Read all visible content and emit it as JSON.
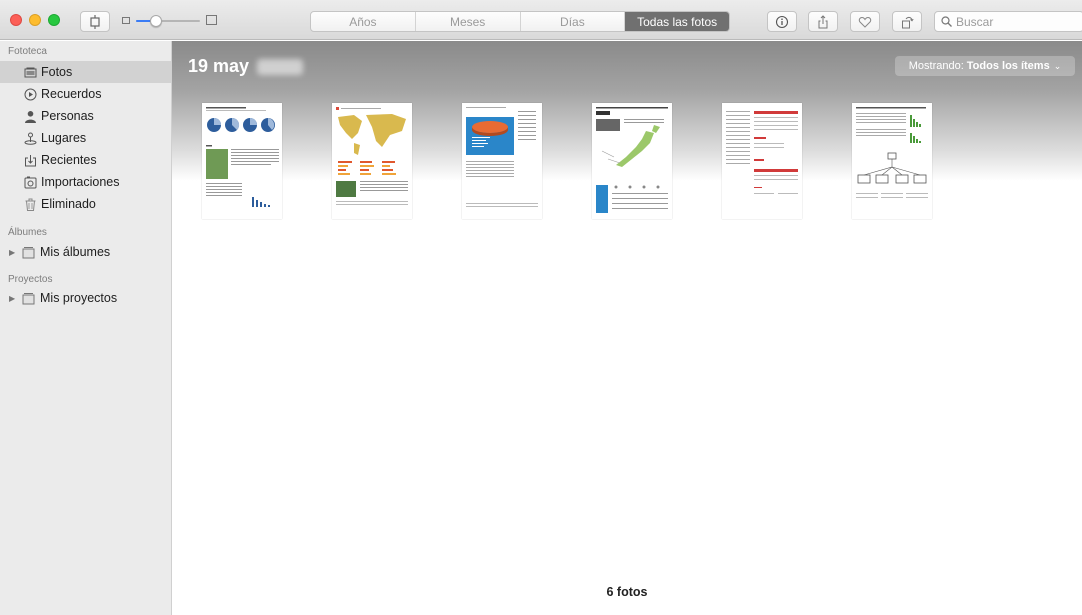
{
  "toolbar": {
    "tabs": [
      {
        "label": "Años",
        "active": false
      },
      {
        "label": "Meses",
        "active": false
      },
      {
        "label": "Días",
        "active": false
      },
      {
        "label": "Todas las fotos",
        "active": true
      }
    ],
    "search_placeholder": "Buscar",
    "icons": [
      "sidebar-toggle-icon",
      "info-icon",
      "share-icon",
      "heart-icon",
      "rotate-icon",
      "search-icon"
    ]
  },
  "sidebar": {
    "sections": {
      "library": "Fototeca",
      "albums": "Álbumes",
      "projects": "Proyectos"
    },
    "library_items": [
      {
        "label": "Fotos",
        "icon": "photos-icon",
        "selected": true
      },
      {
        "label": "Recuerdos",
        "icon": "memories-icon",
        "selected": false
      },
      {
        "label": "Personas",
        "icon": "person-icon",
        "selected": false
      },
      {
        "label": "Lugares",
        "icon": "places-icon",
        "selected": false
      },
      {
        "label": "Recientes",
        "icon": "recent-icon",
        "selected": false
      },
      {
        "label": "Importaciones",
        "icon": "imports-icon",
        "selected": false
      },
      {
        "label": "Eliminado",
        "icon": "trash-icon",
        "selected": false
      }
    ],
    "my_albums": "Mis álbumes",
    "my_projects": "Mis proyectos"
  },
  "main": {
    "date_title": "19 may",
    "showing_prefix": "Mostrando:",
    "showing_value": "Todos los ítems",
    "photo_count": "6 fotos"
  },
  "colors": {
    "selection_gray": "#d2d2d2",
    "active_segment": "#707070",
    "accent_blue": "#3b7cf5"
  }
}
